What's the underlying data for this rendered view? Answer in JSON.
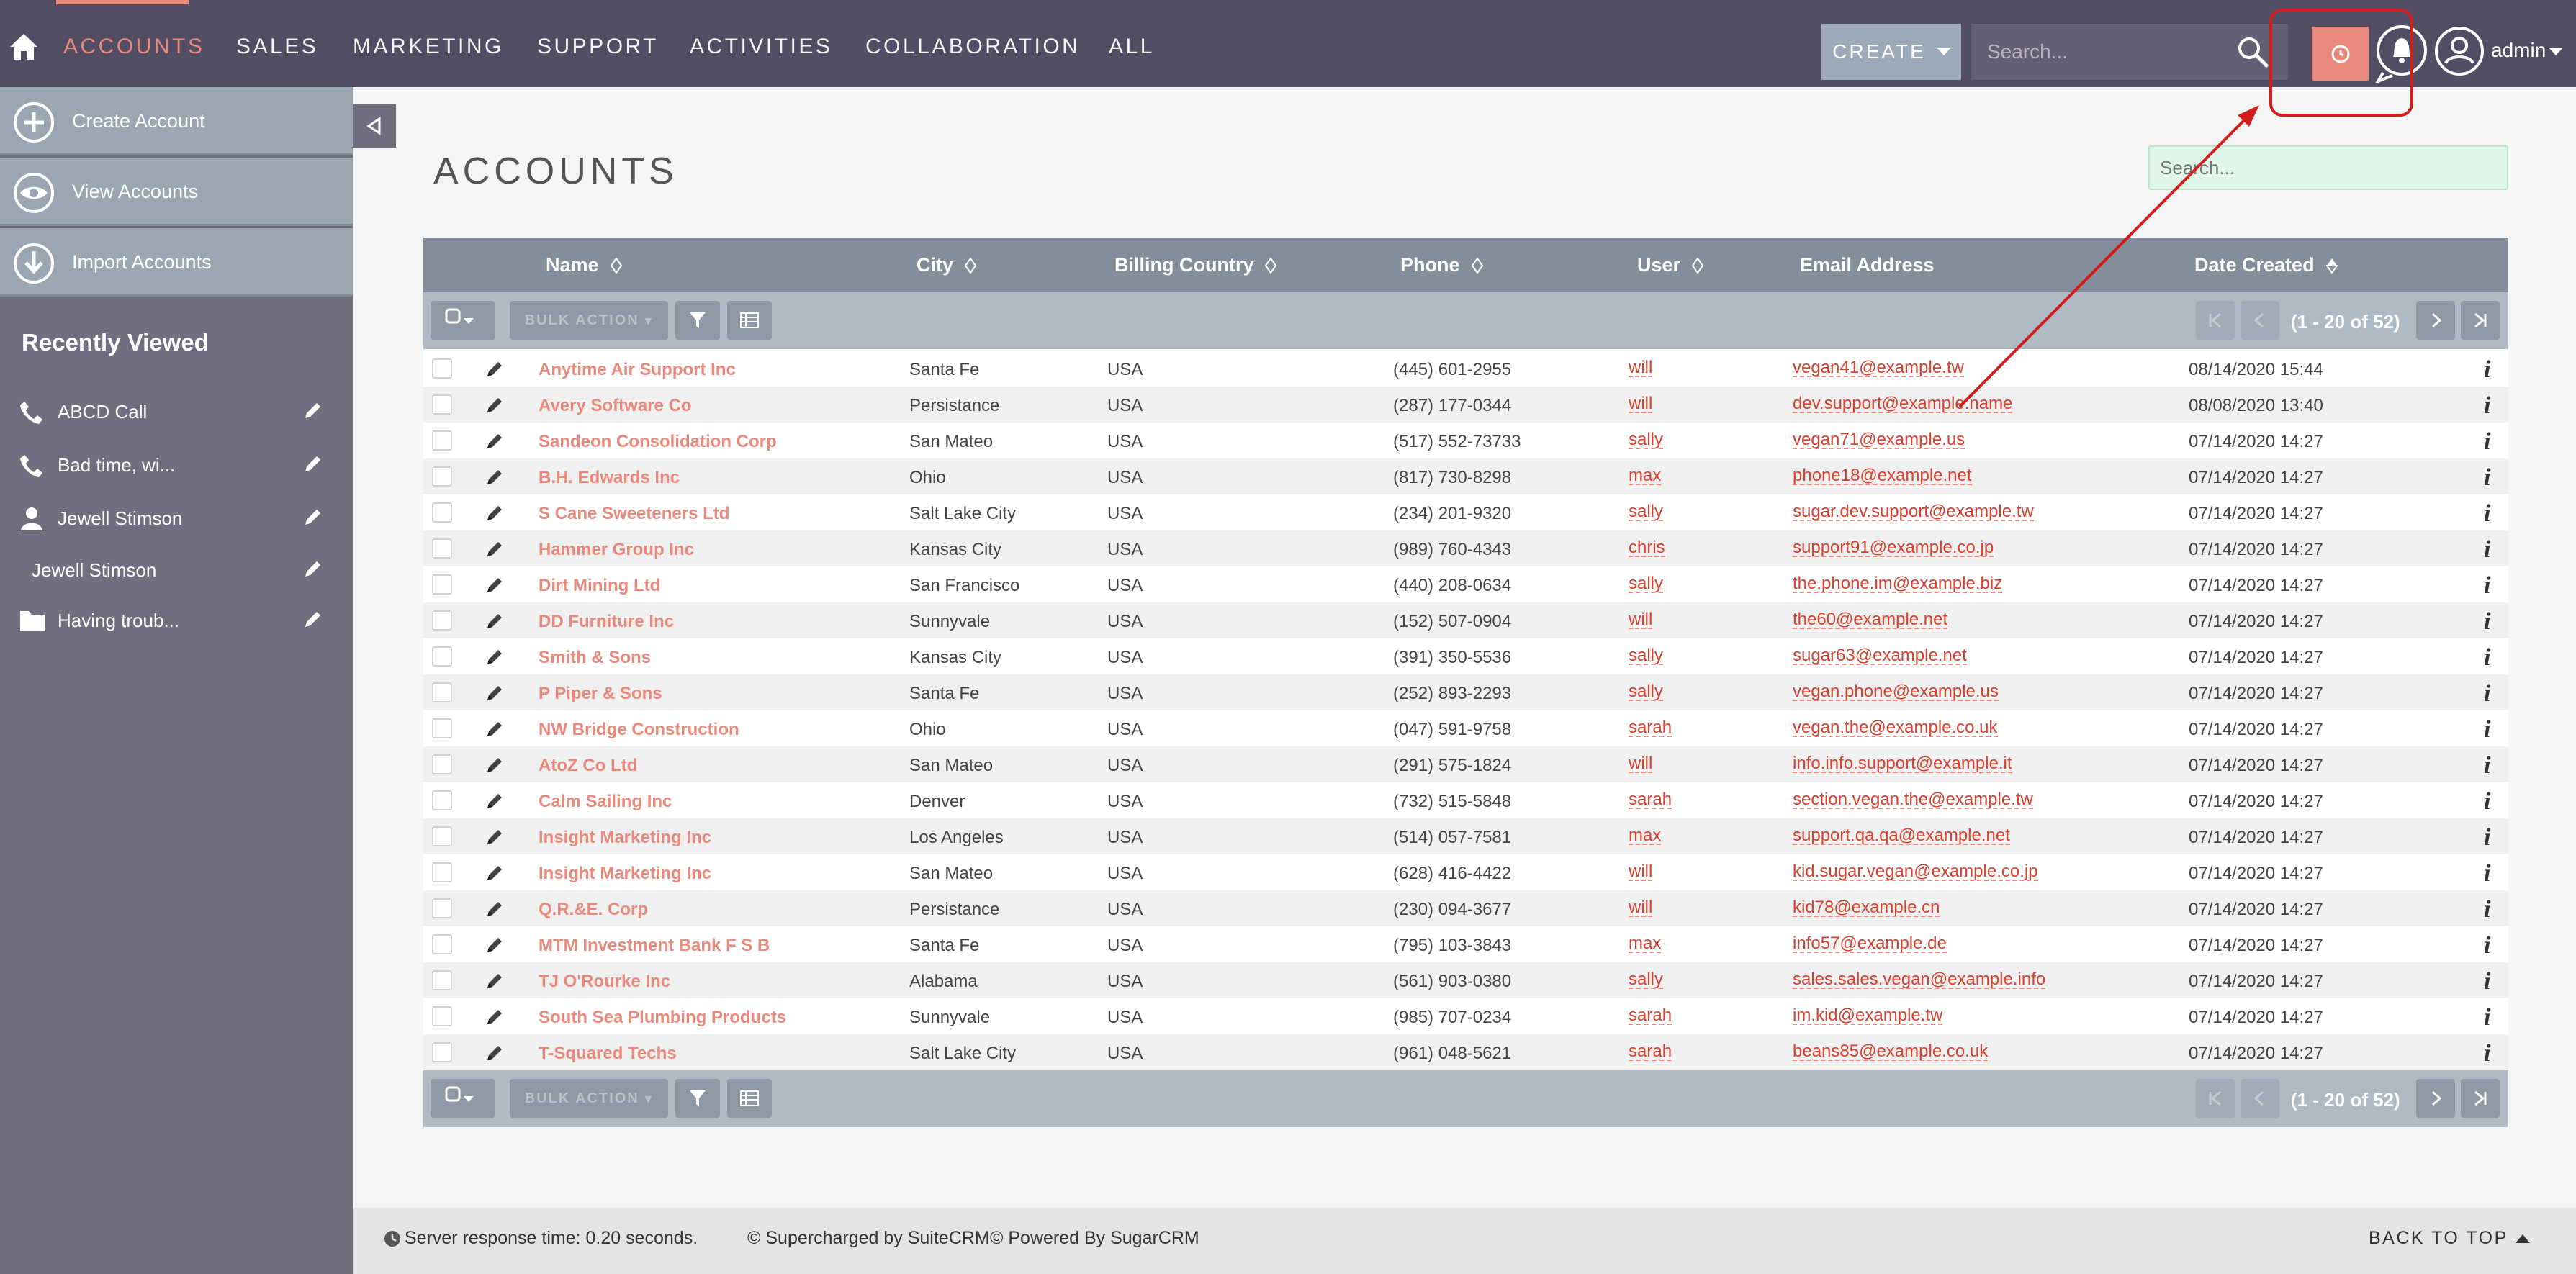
{
  "nav": {
    "items": [
      "ACCOUNTS",
      "SALES",
      "MARKETING",
      "SUPPORT",
      "ACTIVITIES",
      "COLLABORATION",
      "ALL"
    ],
    "create_label": "CREATE",
    "search_placeholder": "Search...",
    "user_name": "admin"
  },
  "sidebar": {
    "actions": [
      "Create Account",
      "View Accounts",
      "Import Accounts"
    ],
    "recently_viewed_title": "Recently Viewed",
    "recent": [
      {
        "label": "ABCD Call",
        "icon": "phone-icon"
      },
      {
        "label": "Bad time, wi...",
        "icon": "phone-icon"
      },
      {
        "label": "Jewell Stimson",
        "icon": "person-icon"
      },
      {
        "label": "Jewell Stimson",
        "icon": "none"
      },
      {
        "label": "Having troub...",
        "icon": "folder-icon"
      }
    ]
  },
  "main": {
    "title": "ACCOUNTS",
    "search_placeholder": "Search...",
    "columns": [
      "Name",
      "City",
      "Billing Country",
      "Phone",
      "User",
      "Email Address",
      "Date Created"
    ],
    "bulk_action_label": "BULK ACTION",
    "pagination": "(1 - 20 of 52)",
    "rows": [
      {
        "name": "Anytime Air Support Inc",
        "city": "Santa Fe",
        "country": "USA",
        "phone": "(445) 601-2955",
        "user": "will",
        "email": "vegan41@example.tw",
        "date": "08/14/2020 15:44"
      },
      {
        "name": "Avery Software Co",
        "city": "Persistance",
        "country": "USA",
        "phone": "(287) 177-0344",
        "user": "will",
        "email": "dev.support@example.name",
        "date": "08/08/2020 13:40"
      },
      {
        "name": "Sandeon Consolidation Corp",
        "city": "San Mateo",
        "country": "USA",
        "phone": "(517) 552-73733",
        "user": "sally",
        "email": "vegan71@example.us",
        "date": "07/14/2020 14:27"
      },
      {
        "name": "B.H. Edwards Inc",
        "city": "Ohio",
        "country": "USA",
        "phone": "(817) 730-8298",
        "user": "max",
        "email": "phone18@example.net",
        "date": "07/14/2020 14:27"
      },
      {
        "name": "S Cane Sweeteners Ltd",
        "city": "Salt Lake City",
        "country": "USA",
        "phone": "(234) 201-9320",
        "user": "sally",
        "email": "sugar.dev.support@example.tw",
        "date": "07/14/2020 14:27"
      },
      {
        "name": "Hammer Group Inc",
        "city": "Kansas City",
        "country": "USA",
        "phone": "(989) 760-4343",
        "user": "chris",
        "email": "support91@example.co.jp",
        "date": "07/14/2020 14:27"
      },
      {
        "name": "Dirt Mining Ltd",
        "city": "San Francisco",
        "country": "USA",
        "phone": "(440) 208-0634",
        "user": "sally",
        "email": "the.phone.im@example.biz",
        "date": "07/14/2020 14:27"
      },
      {
        "name": "DD Furniture Inc",
        "city": "Sunnyvale",
        "country": "USA",
        "phone": "(152) 507-0904",
        "user": "will",
        "email": "the60@example.net",
        "date": "07/14/2020 14:27"
      },
      {
        "name": "Smith & Sons",
        "city": "Kansas City",
        "country": "USA",
        "phone": "(391) 350-5536",
        "user": "sally",
        "email": "sugar63@example.net",
        "date": "07/14/2020 14:27"
      },
      {
        "name": "P Piper & Sons",
        "city": "Santa Fe",
        "country": "USA",
        "phone": "(252) 893-2293",
        "user": "sally",
        "email": "vegan.phone@example.us",
        "date": "07/14/2020 14:27"
      },
      {
        "name": "NW Bridge Construction",
        "city": "Ohio",
        "country": "USA",
        "phone": "(047) 591-9758",
        "user": "sarah",
        "email": "vegan.the@example.co.uk",
        "date": "07/14/2020 14:27"
      },
      {
        "name": "AtoZ Co Ltd",
        "city": "San Mateo",
        "country": "USA",
        "phone": "(291) 575-1824",
        "user": "will",
        "email": "info.info.support@example.it",
        "date": "07/14/2020 14:27"
      },
      {
        "name": "Calm Sailing Inc",
        "city": "Denver",
        "country": "USA",
        "phone": "(732) 515-5848",
        "user": "sarah",
        "email": "section.vegan.the@example.tw",
        "date": "07/14/2020 14:27"
      },
      {
        "name": "Insight Marketing Inc",
        "city": "Los Angeles",
        "country": "USA",
        "phone": "(514) 057-7581",
        "user": "max",
        "email": "support.qa.qa@example.net",
        "date": "07/14/2020 14:27"
      },
      {
        "name": "Insight Marketing Inc",
        "city": "San Mateo",
        "country": "USA",
        "phone": "(628) 416-4422",
        "user": "will",
        "email": "kid.sugar.vegan@example.co.jp",
        "date": "07/14/2020 14:27"
      },
      {
        "name": "Q.R.&E. Corp",
        "city": "Persistance",
        "country": "USA",
        "phone": "(230) 094-3677",
        "user": "will",
        "email": "kid78@example.cn",
        "date": "07/14/2020 14:27"
      },
      {
        "name": "MTM Investment Bank F S B",
        "city": "Santa Fe",
        "country": "USA",
        "phone": "(795) 103-3843",
        "user": "max",
        "email": "info57@example.de",
        "date": "07/14/2020 14:27"
      },
      {
        "name": "TJ O'Rourke Inc",
        "city": "Alabama",
        "country": "USA",
        "phone": "(561) 903-0380",
        "user": "sally",
        "email": "sales.sales.vegan@example.info",
        "date": "07/14/2020 14:27"
      },
      {
        "name": "South Sea Plumbing Products",
        "city": "Sunnyvale",
        "country": "USA",
        "phone": "(985) 707-0234",
        "user": "sarah",
        "email": "im.kid@example.tw",
        "date": "07/14/2020 14:27"
      },
      {
        "name": "T-Squared Techs",
        "city": "Salt Lake City",
        "country": "USA",
        "phone": "(961) 048-5621",
        "user": "sarah",
        "email": "beans85@example.co.uk",
        "date": "07/14/2020 14:27"
      }
    ]
  },
  "footer": {
    "response_time": "Server response time: 0.20 seconds.",
    "suitecrm": "© Supercharged by SuiteCRM",
    "sugarcrm": "© Powered By SugarCRM",
    "back_to_top": "BACK TO TOP"
  },
  "colors": {
    "nav_bg": "#534d64",
    "accent": "#e8897b",
    "highlight": "#d21d1d"
  }
}
